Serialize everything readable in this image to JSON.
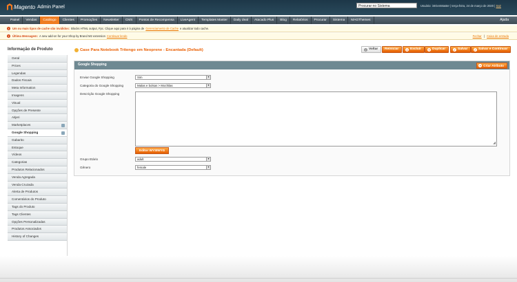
{
  "header": {
    "logo_word": "Magento",
    "logo_sub": "Admin Panel",
    "search_value": "Procurar no Sistema",
    "user_prefix": "Usuário: ",
    "user_name": "intGenMaster",
    "date_text": " | terça-feira, 24 de março de 2020 | ",
    "logout": "Sair"
  },
  "nav": {
    "items": [
      "Painel",
      "Vendas",
      "Catálogo",
      "Clientes",
      "Promoções",
      "Newsletter",
      "CMS",
      "Pontos de Recompensa",
      "LiveAgent",
      "Templates Master",
      "Daily deal",
      "Atacado Plus",
      "Blog",
      "Relatórios",
      "Procurar",
      "Sistema",
      "MAGThemes"
    ],
    "active": "Catálogo",
    "help": "Ajuda"
  },
  "notices": {
    "cache_bold": "Um ou mais tipos de cache são inválidos:",
    "cache_text": "Blocks HTML output, Fpc. Clique aqui para ir à página de",
    "cache_link": "Gerenciamento de Cache",
    "cache_tail": "e atualizar todo cache.",
    "msg_bold": "Última Mensagem:",
    "msg_text": "A new add-on for your Shop by Brand M2 extension",
    "msg_link": "Continuar lendo",
    "msg_right_close": "Fechar",
    "msg_right_sep": " | ",
    "msg_right_inbox": "Caixa de entrada"
  },
  "sidebar": {
    "title": "Informação de Produto",
    "tabs": [
      "Geral",
      "Prices",
      "Legendas",
      "Dados Fiscais",
      "Meta Information",
      "Imagens",
      "Visual",
      "Opções de Presente",
      "Aitjeri",
      "Marketplaces",
      "Google Shopping",
      "Gabarito",
      "Estoque",
      "Vídeos",
      "Categorias",
      "Produtos Relacionados",
      "Venda Agregada",
      "Venda Cruzada",
      "Alerta de Produtos",
      "Comentários do Produto",
      "Tags do Produto",
      "Tags Clientes",
      "Opções Personalizadas",
      "Produtos Associados",
      "History of Changes"
    ],
    "active_tab": "Google Shopping"
  },
  "page": {
    "title": "Case Para Notebook Tritengo em Neoprene - Encantada (Default)",
    "buttons": {
      "back": "Voltar",
      "reset": "Reiniciar",
      "delete": "Excluir",
      "duplicate": "Duplicar",
      "save": "Salvar",
      "save_continue": "Salvar e Continuar"
    }
  },
  "section": {
    "title": "Google Shopping",
    "create_attr": "Criar Atributo",
    "fields": {
      "enviar_label": "Enviar Google Shopping",
      "enviar_value": "Sim",
      "categoria_label": "Categoria do Google Shopping",
      "categoria_value": "Malas e bolsas > Mochilas",
      "descricao_label": "Descrição Google Shopping",
      "wysiwyg_button": "Editor WYSIWYG",
      "grupo_label": "Grupo Etário",
      "grupo_value": "adult",
      "genero_label": "Gênero",
      "genero_value": "female"
    }
  },
  "colors": {
    "accent": "#ef7d22",
    "header_bg": "#1d3748",
    "title": "#eb5e00"
  }
}
